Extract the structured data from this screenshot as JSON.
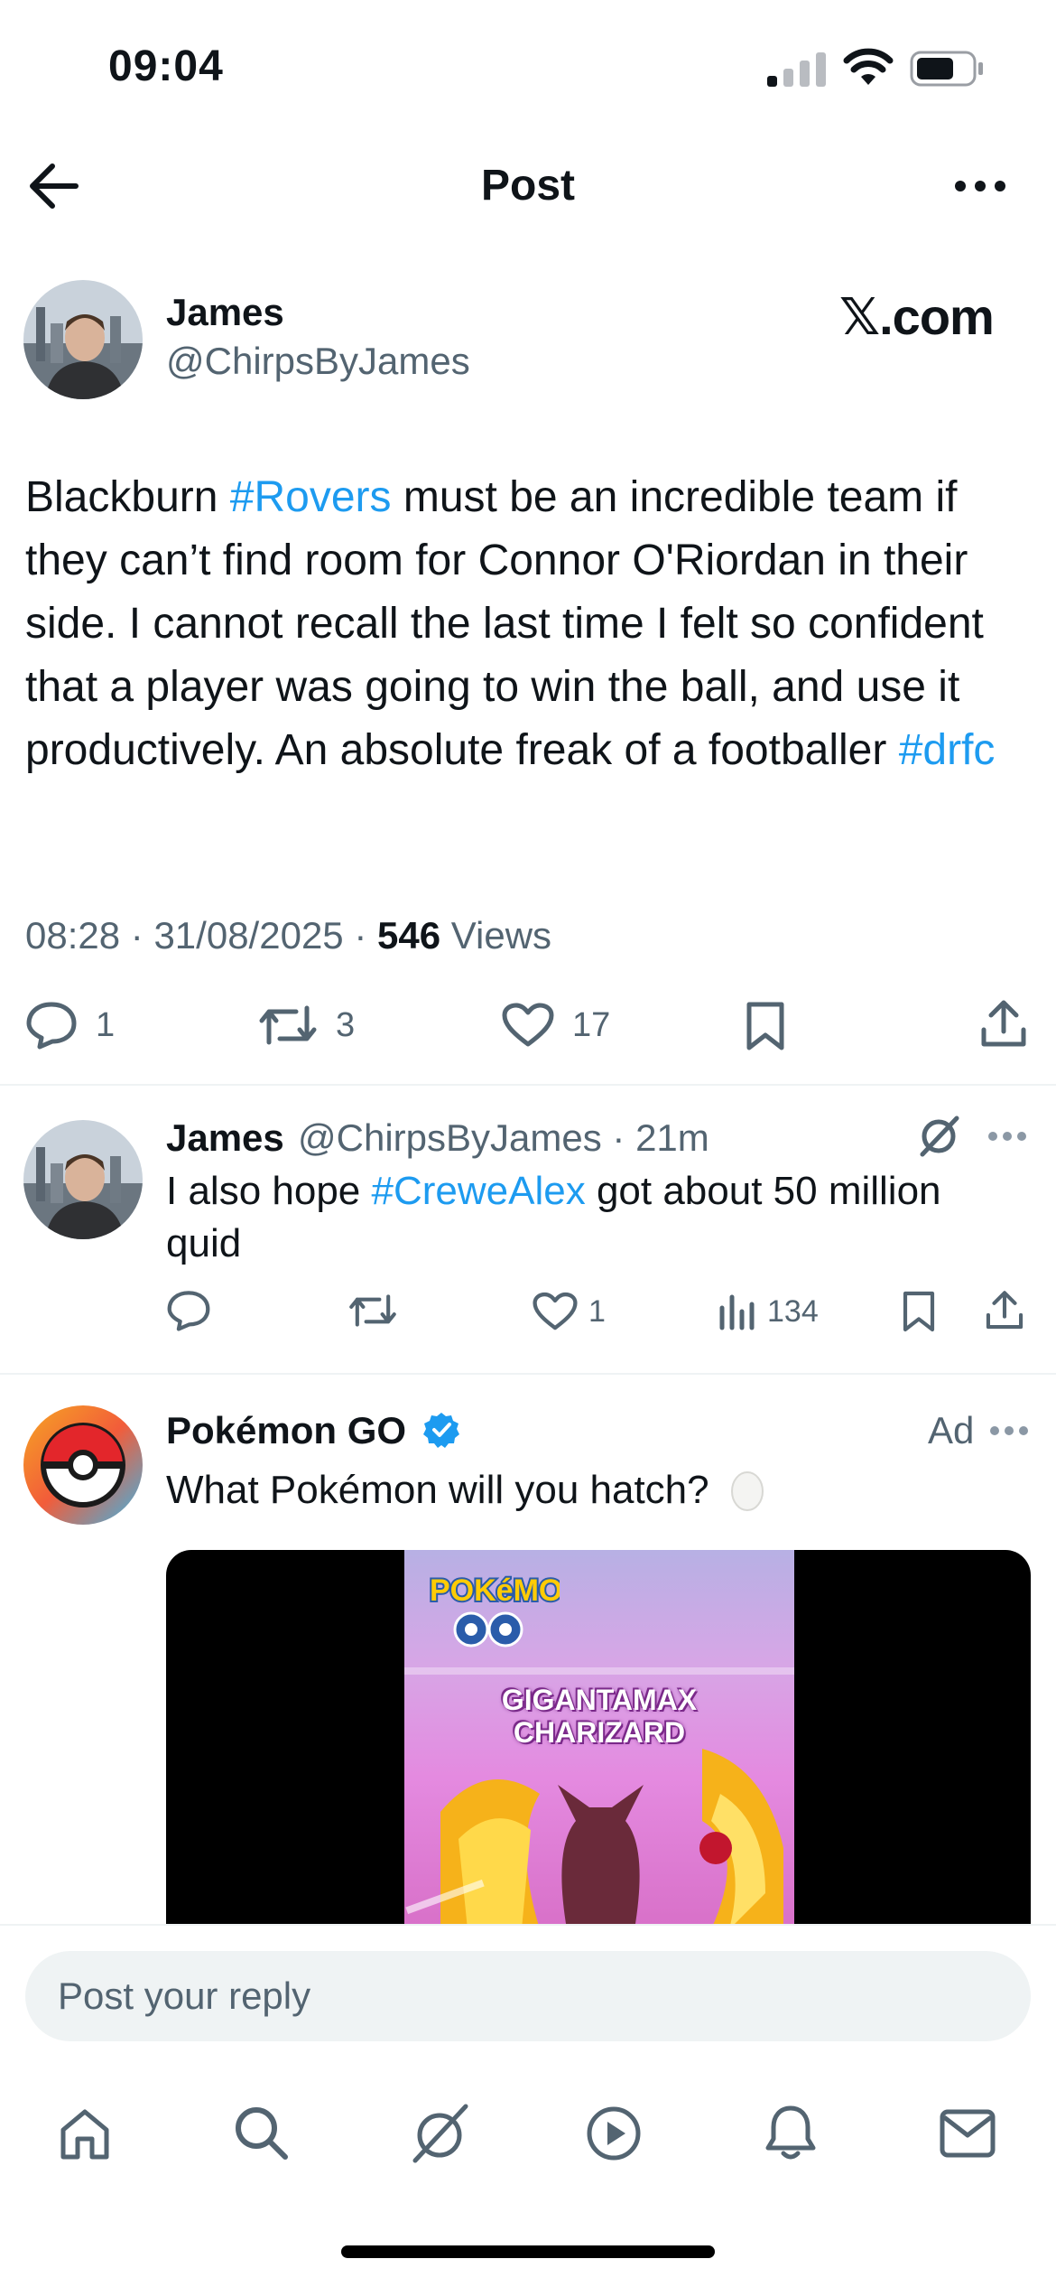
{
  "status_bar": {
    "time": "09:04",
    "signal_icon": "signal-icon",
    "wifi_icon": "wifi-icon",
    "battery_icon": "battery-icon"
  },
  "header": {
    "title": "Post",
    "back_icon": "back-arrow-icon",
    "more_icon": "more-icon"
  },
  "post": {
    "author_name": "James",
    "author_handle": "@ChirpsByJames",
    "source_label": "𝕏.com",
    "text_parts": {
      "p1": "Blackburn ",
      "tag1": "#Rovers",
      "p2": " must be an incredible team if they can’t find room for Connor O'Riordan in their side. I cannot recall the last time I felt so confident that a player was going to win the ball, and use it productively. An absolute freak of a footballer ",
      "tag2": "#drfc"
    },
    "meta": {
      "time": "08:28",
      "date": "31/08/2025",
      "views_count": "546",
      "views_label": "Views",
      "sep": "·"
    },
    "actions": {
      "replies": "1",
      "reposts": "3",
      "likes": "17"
    }
  },
  "reply": {
    "author_name": "James",
    "author_handle": "@ChirpsByJames",
    "age": "21m",
    "text_parts": {
      "p1": "I also hope ",
      "tag": "#CreweAlex",
      "p2": " got about 50 million quid"
    },
    "actions": {
      "replies": "",
      "reposts": "",
      "likes": "1",
      "views": "134"
    }
  },
  "ad": {
    "advertiser": "Pokémon GO",
    "verified": true,
    "label": "Ad",
    "text": "What Pokémon will you hatch?",
    "video_caption": "GIGANTAMAX\nCHARIZARD",
    "logo_text": "POKÉMON GO"
  },
  "reply_bar": {
    "placeholder": "Post your reply"
  },
  "tab_bar": [
    "home-icon",
    "search-icon",
    "grok-icon",
    "video-icon",
    "notifications-icon",
    "messages-icon"
  ],
  "colors": {
    "accent": "#1d9bf0",
    "text": "#0f1419",
    "muted": "#536471",
    "divider": "#eff3f4"
  }
}
